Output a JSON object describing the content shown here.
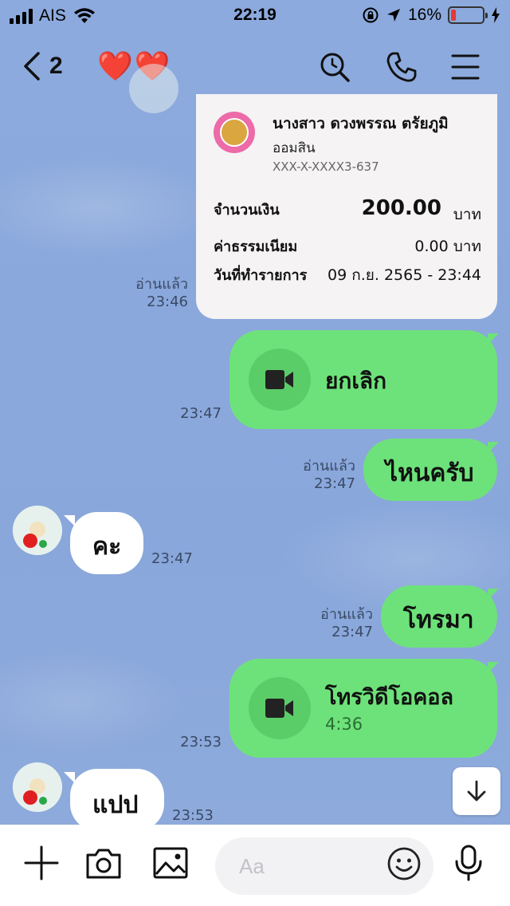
{
  "status_bar": {
    "carrier": "AIS",
    "time": "22:19",
    "battery": "16%",
    "battery_level": 0.16
  },
  "header": {
    "back_count": "2",
    "title": "❤️❤️"
  },
  "transfer_card": {
    "name": "นางสาว ดวงพรรณ ตรัยภูมิ",
    "bank": "ออมสิน",
    "account": "XXX-X-XXXX3-637",
    "amount_label": "จำนวนเงิน",
    "amount_value": "200.00",
    "amount_unit": "บาท",
    "fee_label": "ค่าธรรมเนียม",
    "fee_value": "0.00 บาท",
    "date_label": "วันที่ทำรายการ",
    "date_value": "09 ก.ย. 2565 - 23:44",
    "read": "อ่านแล้ว",
    "time": "23:46"
  },
  "messages": [
    {
      "side": "right",
      "type": "video",
      "text": "ยกเลิก",
      "time": "23:47"
    },
    {
      "side": "right",
      "type": "text",
      "text": "ไหนครับ",
      "read": "อ่านแล้ว",
      "time": "23:47"
    },
    {
      "side": "left",
      "type": "text",
      "text": "คะ",
      "time": "23:47"
    },
    {
      "side": "right",
      "type": "text",
      "text": "โทรมา",
      "read": "อ่านแล้ว",
      "time": "23:47"
    },
    {
      "side": "right",
      "type": "video",
      "text": "โทรวิดีโอคอล",
      "duration": "4:36",
      "time": "23:53"
    },
    {
      "side": "left",
      "type": "text",
      "text": "แปป",
      "time": "23:53"
    }
  ],
  "input": {
    "placeholder": "Aa"
  },
  "icons": [
    "search-icon",
    "phone-icon",
    "menu-icon",
    "video-camera-icon",
    "plus-icon",
    "camera-icon",
    "image-icon",
    "emoji-icon",
    "microphone-icon",
    "arrow-down-icon"
  ]
}
